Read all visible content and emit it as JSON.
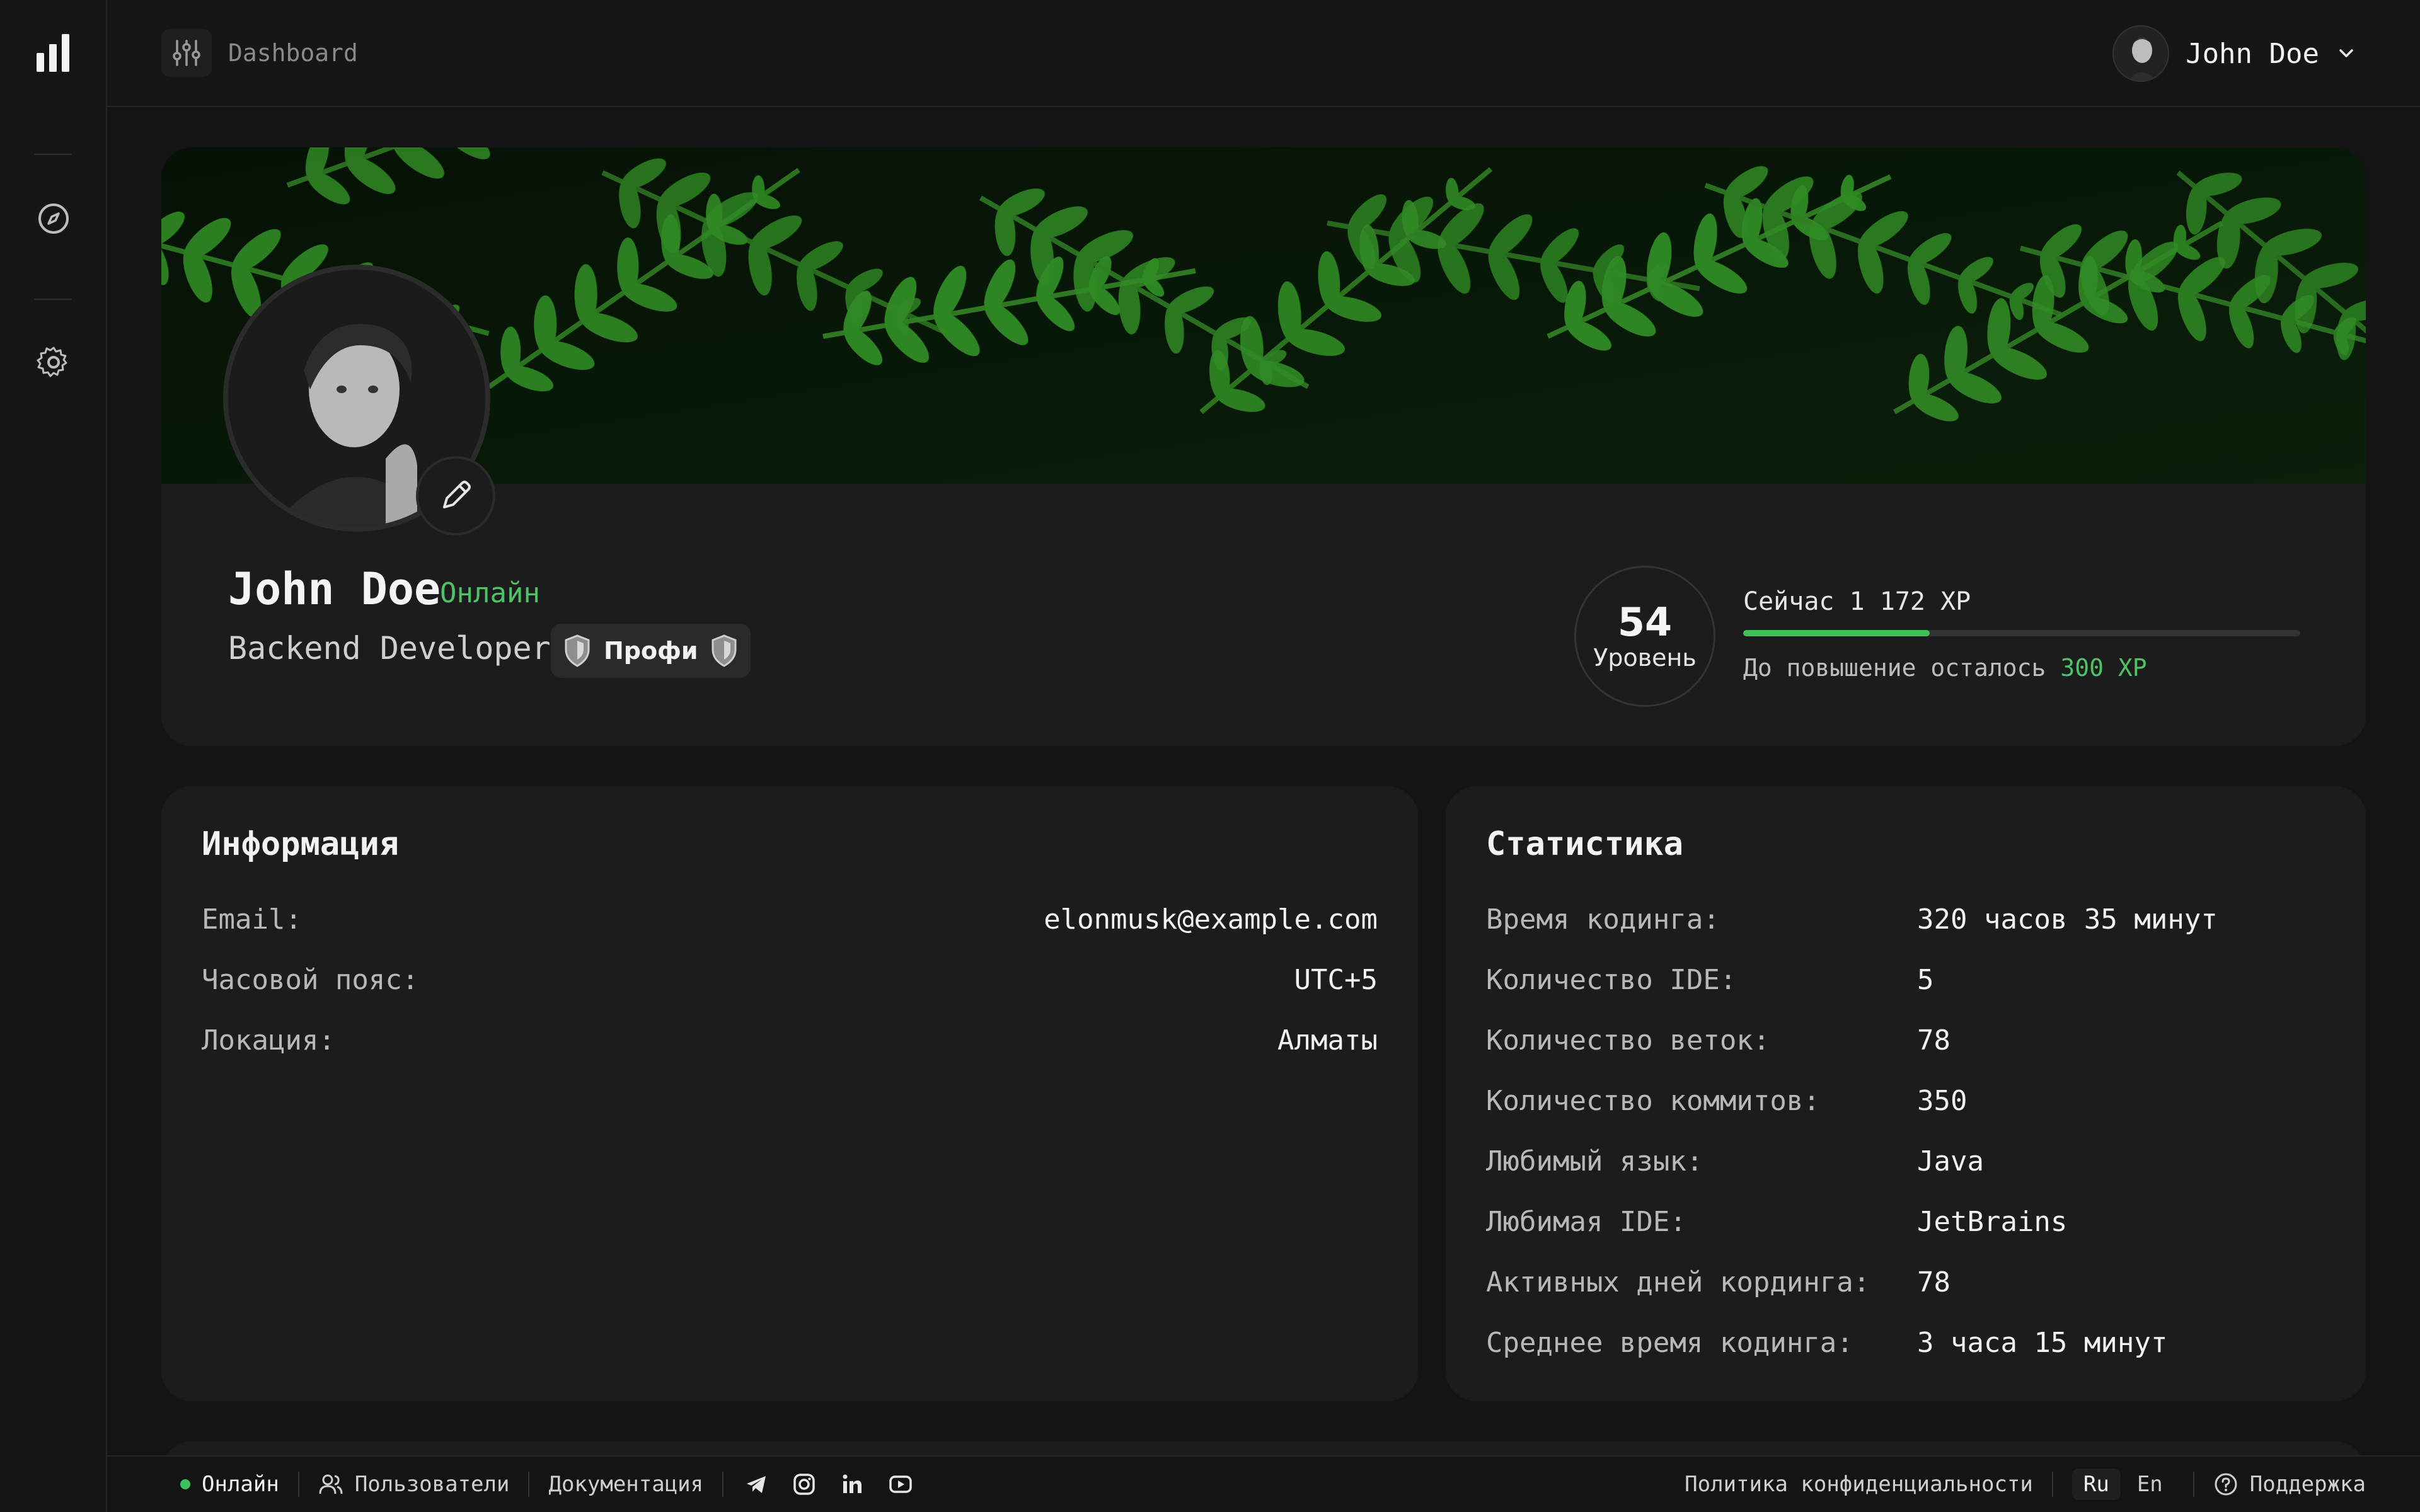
{
  "topbar": {
    "title": "Dashboard",
    "user_name": "John Doe"
  },
  "profile": {
    "name": "John Doe",
    "status": "Онлайн",
    "role": "Backend Developer",
    "badge": "Профи",
    "level_number": "54",
    "level_label": "Уровень",
    "xp_now": "Сейчас 1 172 XP",
    "xp_left_prefix": "До повышение осталось ",
    "xp_left_value": "300 XP",
    "xp_progress_fraction": 0.335
  },
  "info": {
    "title": "Информация",
    "rows": [
      {
        "label": "Email:",
        "value": "elonmusk@example.com"
      },
      {
        "label": "Часовой пояс:",
        "value": "UTC+5"
      },
      {
        "label": "Локация:",
        "value": "Алматы"
      }
    ]
  },
  "stats": {
    "title": "Статистика",
    "rows": [
      {
        "label": "Время кодинга:",
        "value": "320 часов 35 минут"
      },
      {
        "label": "Количество IDE:",
        "value": "5"
      },
      {
        "label": "Количество веток:",
        "value": "78"
      },
      {
        "label": "Количество коммитов:",
        "value": "350"
      },
      {
        "label": "Любимый язык:",
        "value": "Java"
      },
      {
        "label": "Любимая IDE:",
        "value": "JetBrains"
      },
      {
        "label": "Активных дней кординга:",
        "value": "78"
      },
      {
        "label": "Среднее время кодинга:",
        "value": "3 часа 15 минут"
      }
    ]
  },
  "footer": {
    "online": "Онлайн",
    "users": "Пользователи",
    "docs": "Документация",
    "privacy": "Политика конфиденциальности",
    "lang_ru": "Ru",
    "lang_en": "En",
    "support": "Поддержка"
  },
  "colors": {
    "accent": "#3ec25a",
    "background": "#141414",
    "card": "#1c1c1c"
  },
  "icons": {
    "logo": "bar-chart-icon",
    "nav_1": "compass-icon",
    "nav_2": "gear-icon",
    "filter": "sliders-icon",
    "dropdown": "chevron-down-icon",
    "edit": "pencil-icon",
    "badge": "shield-icon",
    "users": "users-icon",
    "social": [
      "telegram-icon",
      "instagram-icon",
      "linkedin-icon",
      "youtube-icon"
    ],
    "support": "question-circle-icon"
  }
}
